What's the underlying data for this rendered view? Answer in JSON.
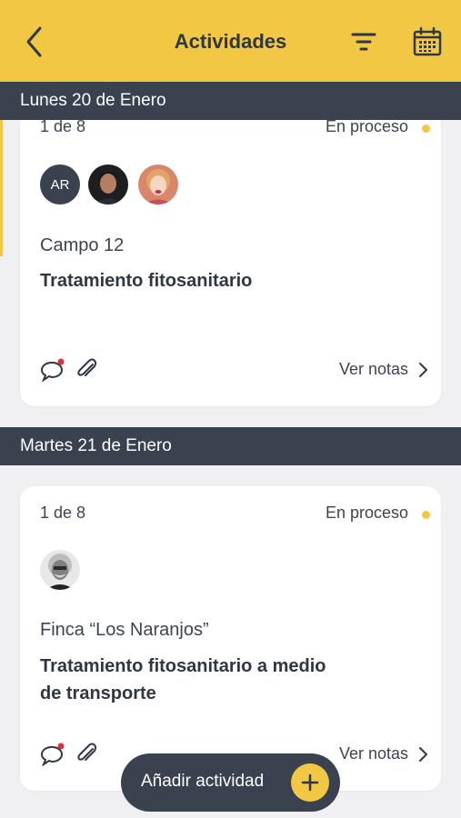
{
  "header": {
    "title": "Actividades",
    "back_icon": "chevron-left-icon",
    "filter_icon": "filter-icon",
    "calendar_icon": "calendar-icon",
    "background": "#f2c744"
  },
  "sections": [
    {
      "date": "Lunes 20 de Enero",
      "card": {
        "count": "1 de 8",
        "status": "En proceso",
        "avatars": [
          {
            "type": "initials",
            "text": "AR"
          },
          {
            "type": "photo"
          },
          {
            "type": "photo"
          }
        ],
        "location": "Campo 12",
        "title": "Tratamiento fitosanitario",
        "notes_label": "Ver notas"
      }
    },
    {
      "date": "Martes 21 de Enero",
      "card": {
        "count": "1 de 8",
        "status": "En proceso",
        "avatars": [
          {
            "type": "photo"
          }
        ],
        "location": "Finca “Los Naranjos”",
        "title_lines": [
          "Tratamiento fitosanitario a medio",
          "de transporte"
        ],
        "notes_label": "Ver notas"
      }
    }
  ],
  "fab": {
    "label": "Añadir actividad",
    "icon": "plus-icon"
  },
  "colors": {
    "accent": "#f2c744",
    "dark": "#3a4250",
    "notification": "#e0303a"
  }
}
